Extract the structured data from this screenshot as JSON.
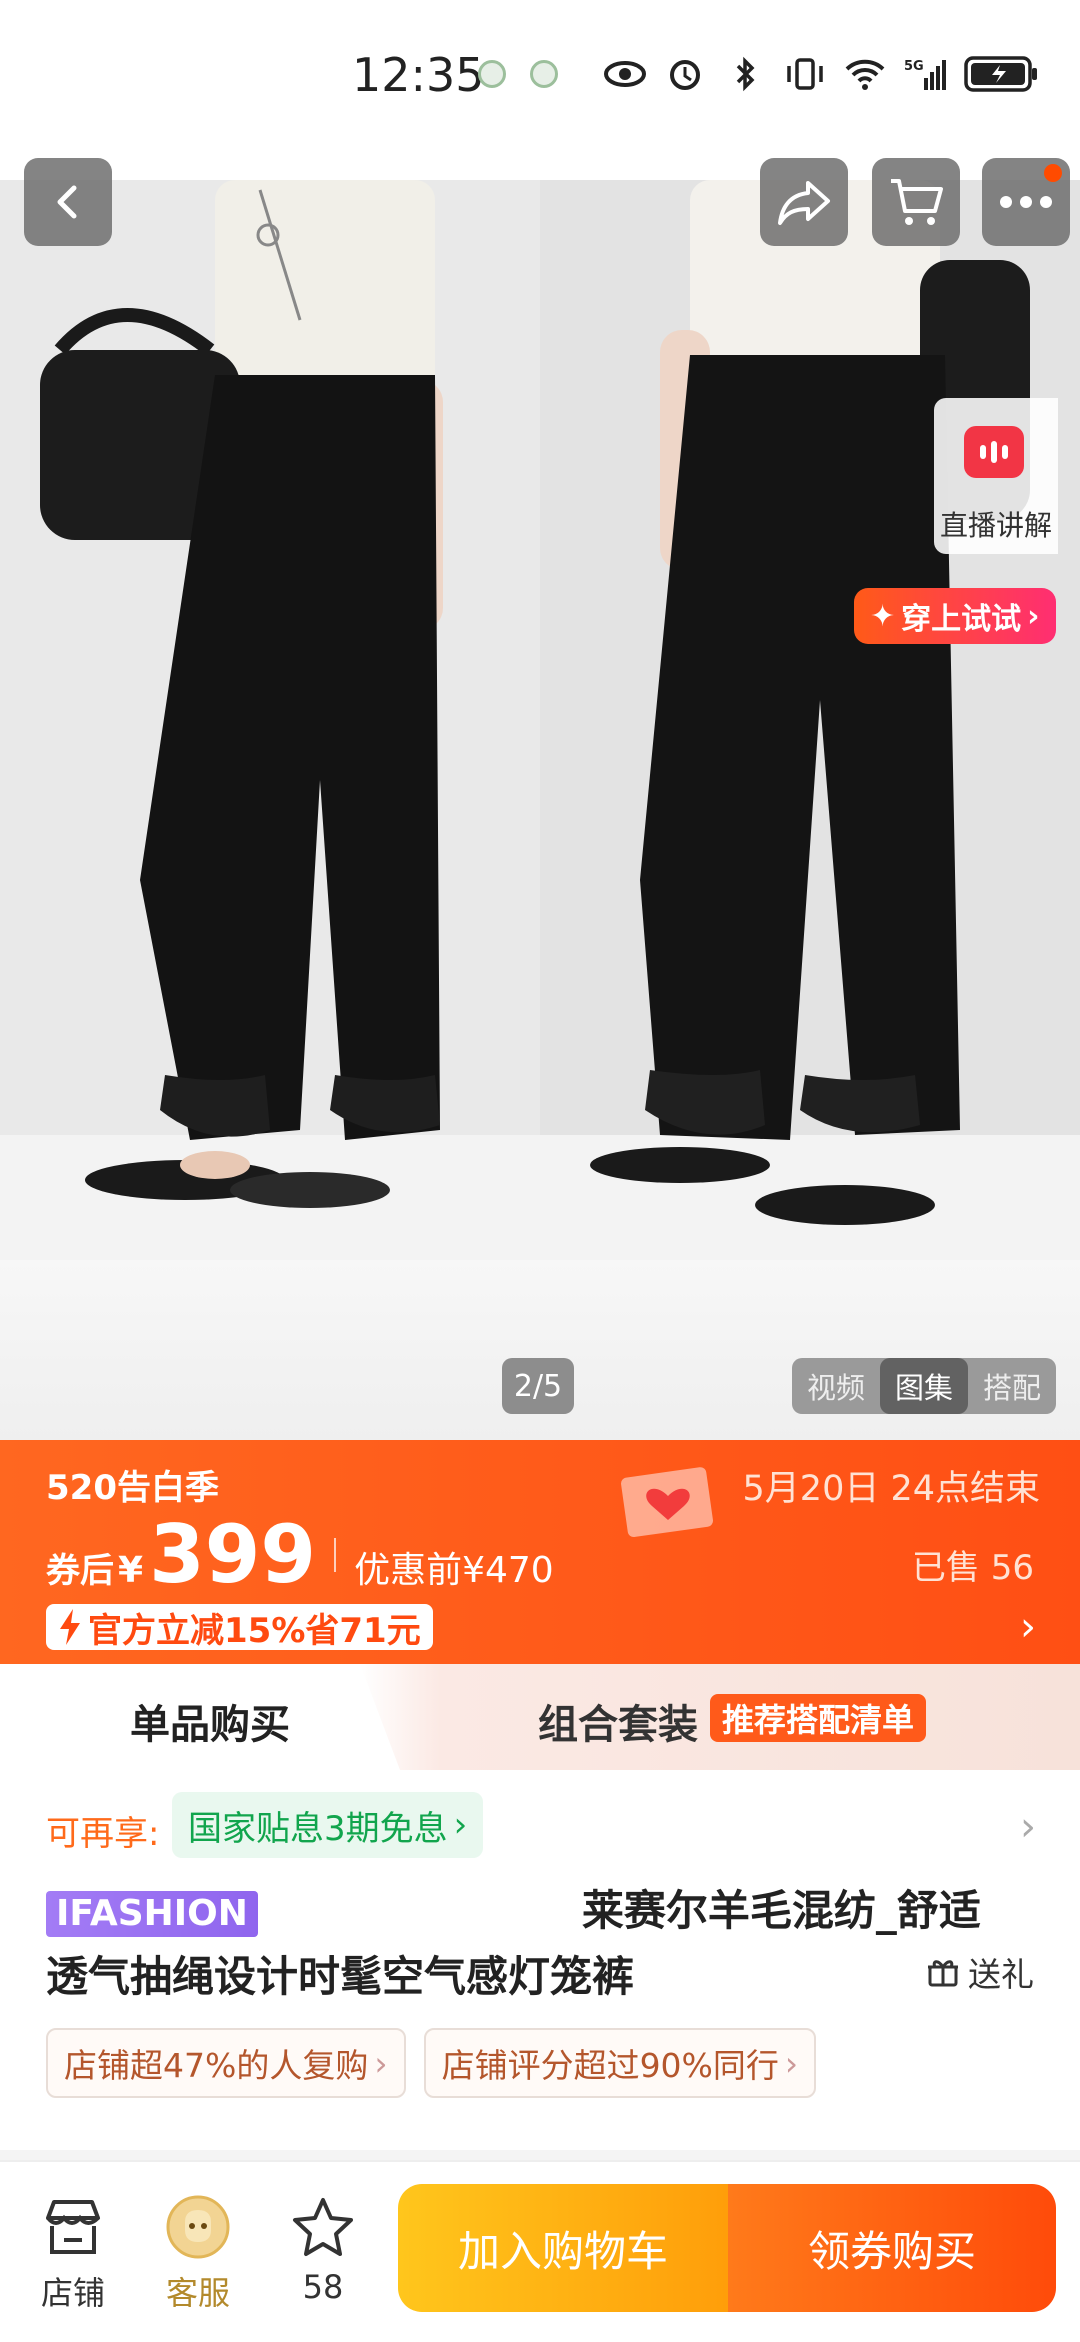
{
  "status": {
    "time": "12:35"
  },
  "hero": {
    "pager": "2/5",
    "media_tabs": [
      "视频",
      "图集",
      "搭配"
    ],
    "active_tab": 1,
    "live_label": "直播讲解",
    "tryon_label": "穿上试试"
  },
  "promo": {
    "event": "520告白季",
    "deadline": "5月20日 24点结束",
    "after_coupon_label": "券后",
    "currency": "¥",
    "price": "399",
    "before_label": "优惠前¥470",
    "sold": "已售 56",
    "official": "官方立减15%省71元"
  },
  "purchase_tabs": {
    "single": "单品购买",
    "combo": "组合套装",
    "combo_badge": "推荐搭配清单"
  },
  "product": {
    "extra_label": "可再享:",
    "extra_chip": "国家贴息3期免息",
    "brand_badge": "IFASHION",
    "title_line1": "莱赛尔羊毛混纺_舒适",
    "title_line2": "透气抽绳设计时髦空气感灯笼裤",
    "gift": "送礼",
    "chips": [
      "店铺超47%的人复购",
      "店铺评分超过90%同行"
    ]
  },
  "bottom": {
    "store": "店铺",
    "service": "客服",
    "favorites": "58",
    "add_cart": "加入购物车",
    "buy": "领券购买"
  },
  "colors": {
    "accent": "#ff5a14",
    "cart": "#ffb214",
    "live": "#f23545",
    "green": "#11a54d"
  },
  "icons": [
    "back-icon",
    "share-icon",
    "cart-icon",
    "more-icon",
    "store-icon",
    "service-icon",
    "star-icon",
    "gift-icon",
    "lightning-icon",
    "envelope-icon"
  ]
}
